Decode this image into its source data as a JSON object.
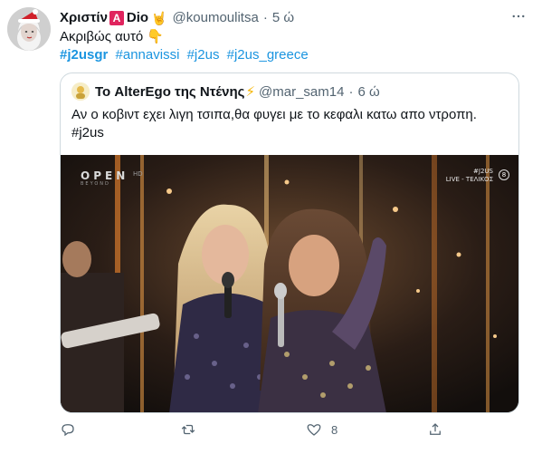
{
  "tweet": {
    "display_name_part1": "Χριστίν",
    "badge": "A",
    "display_name_part2": "Dio",
    "hand_emoji": "🤘",
    "handle": "@koumoulitsa",
    "separator": "·",
    "time": "5 ώ",
    "text": "Ακριβώς αυτό",
    "text_emoji": "👇",
    "hashtags": [
      "#j2usgr",
      "#annavissi",
      "#j2us",
      "#j2us_greece"
    ],
    "more_icon": "more-horizontal-icon"
  },
  "quoted_tweet": {
    "display_name": "Το AlterEgo της Ντένης",
    "name_emoji": "⚡",
    "handle": "@mar_sam14",
    "separator": "·",
    "time": "6 ώ",
    "text_line1": "Αν ο κοβιντ εχει λιγη τσιπα,θα φυγει με το κεφαλι κατω απο ντροπη.",
    "text_line2": "#j2us",
    "media": {
      "channel_logo": "OPEN",
      "channel_sub": "BEYOND",
      "channel_hd": "HD",
      "tag_line1": "#J2US",
      "tag_line2": "LIVE - ΤΕΛΙΚΟΣ",
      "rating": "8"
    }
  },
  "actions": {
    "reply": {
      "icon": "reply-icon",
      "count": ""
    },
    "retweet": {
      "icon": "retweet-icon",
      "count": ""
    },
    "like": {
      "icon": "heart-icon",
      "count": "8"
    },
    "share": {
      "icon": "share-icon",
      "count": ""
    }
  },
  "colors": {
    "link": "#1b95e0",
    "muted": "#536471",
    "border": "#cfd9de",
    "badge": "#e0245e"
  }
}
